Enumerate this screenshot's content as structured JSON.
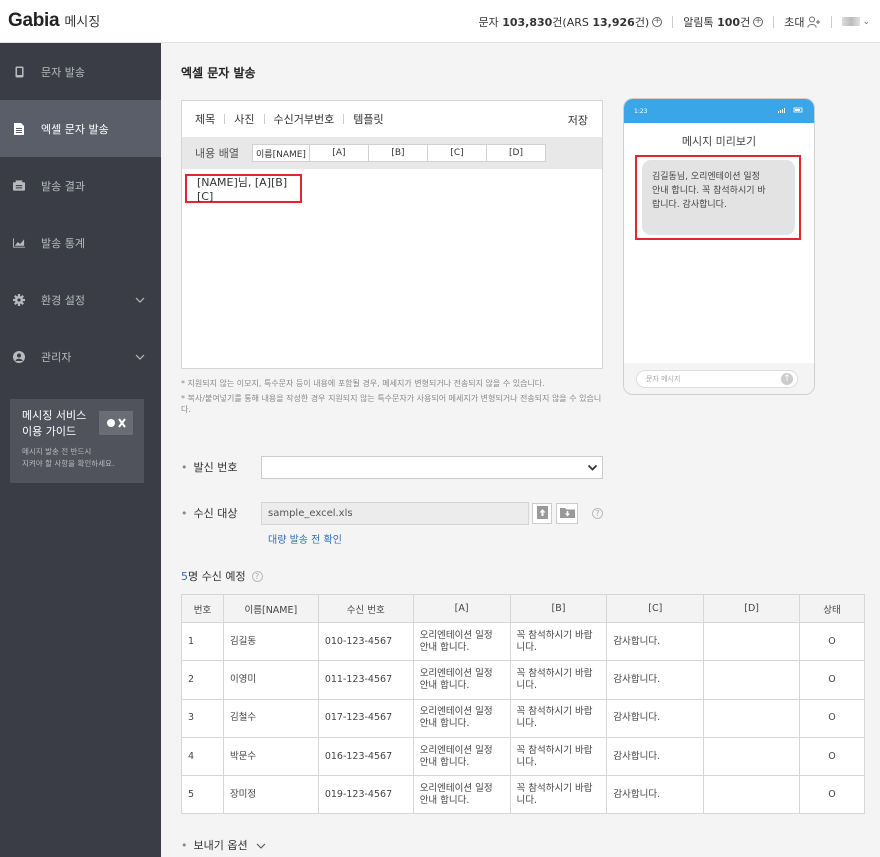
{
  "header": {
    "logo": "Gabia",
    "logo_sub": "메시징",
    "sms_label": "문자",
    "sms_count": "103,830",
    "sms_unit": "건(ARS",
    "ars_count": "13,926",
    "ars_unit": "건)",
    "alimtalk_label": "알림톡",
    "alimtalk_count": "100",
    "alimtalk_unit": "건",
    "invite_label": "초대"
  },
  "sidebar": {
    "items": [
      {
        "label": "문자 발송",
        "icon": "phone-icon"
      },
      {
        "label": "엑셀 문자 발송",
        "icon": "document-icon"
      },
      {
        "label": "발송 결과",
        "icon": "result-icon"
      },
      {
        "label": "발송 통계",
        "icon": "chart-icon"
      },
      {
        "label": "환경 설정",
        "icon": "gear-icon"
      },
      {
        "label": "관리자",
        "icon": "user-icon"
      }
    ],
    "guide": {
      "title_line1": "메시징 서비스",
      "title_line2": "이용 가이드",
      "desc_line1": "메시지 발송 전 반드시",
      "desc_line2": "지켜야 할 사항을 확인하세요."
    }
  },
  "main": {
    "page_title": "엑셀 문자 발송",
    "editor": {
      "tabs": [
        "제목",
        "사진",
        "수신거부번호",
        "템플릿"
      ],
      "save_label": "저장",
      "order_label": "내용 배열",
      "order_cells": [
        "이름[NAME]",
        "[A]",
        "[B]",
        "[C]",
        "[D]"
      ],
      "message": "[NAME]님, [A][B][C]"
    },
    "notes": [
      "*  지원되지 않는 이모지, 특수문자 등이 내용에 포함될 경우, 메세지가 변형되거나 전송되지 않을 수 있습니다.",
      "*  복사/붙여넣기를 통해 내용을 작성한 경우 지원되지 않는 특수문자가 사용되어 메세지가 변형되거나 전송되지 않을 수 있습니다."
    ],
    "sender_label": "발신 번호",
    "sender_value": "",
    "recipient_label": "수신 대상",
    "file_name": "sample_excel.xls",
    "bulk_link": "대량 발송 전 확인",
    "recv_count": "5",
    "recv_title_suffix": "명 수신 예정",
    "table": {
      "headers": [
        "번호",
        "이름[NAME]",
        "수신 번호",
        "[A]",
        "[B]",
        "[C]",
        "[D]",
        "상태"
      ],
      "rows": [
        {
          "no": "1",
          "name": "김길동",
          "phone": "010-123-4567",
          "a1": "오리엔테이션 일정",
          "a2": "안내 합니다.",
          "b1": "꼭 참석하시기 바랍",
          "b2": "니다.",
          "c": "감사합니다.",
          "d": "",
          "status": "O"
        },
        {
          "no": "2",
          "name": "이영미",
          "phone": "011-123-4567",
          "a1": "오리엔테이션 일정",
          "a2": "안내 합니다.",
          "b1": "꼭 참석하시기 바랍",
          "b2": "니다.",
          "c": "감사합니다.",
          "d": "",
          "status": "O"
        },
        {
          "no": "3",
          "name": "김철수",
          "phone": "017-123-4567",
          "a1": "오리엔테이션 일정",
          "a2": "안내 합니다.",
          "b1": "꼭 참석하시기 바랍",
          "b2": "니다.",
          "c": "감사합니다.",
          "d": "",
          "status": "O"
        },
        {
          "no": "4",
          "name": "박문수",
          "phone": "016-123-4567",
          "a1": "오리엔테이션 일정",
          "a2": "안내 합니다.",
          "b1": "꼭 참석하시기 바랍",
          "b2": "니다.",
          "c": "감사합니다.",
          "d": "",
          "status": "O"
        },
        {
          "no": "5",
          "name": "장미정",
          "phone": "019-123-4567",
          "a1": "오리엔테이션 일정",
          "a2": "안내 합니다.",
          "b1": "꼭 참석하시기 바랍",
          "b2": "니다.",
          "c": "감사합니다.",
          "d": "",
          "status": "O"
        }
      ]
    },
    "send_options_label": "보내기 옵션"
  },
  "preview": {
    "time": "1:23",
    "title": "메시지 미리보기",
    "bubble_line1": "김길동님, 오리엔테이션 일정",
    "bubble_line2": "안내 합니다. 꼭 참석하시기 바",
    "bubble_line3": "랍니다. 감사합니다.",
    "input_placeholder": "문자 메시지"
  },
  "colors": {
    "sidebar_bg": "#3a3d45",
    "sidebar_active": "#5a5e68",
    "highlight_red": "#e2262e",
    "link_blue": "#2e6fb7",
    "phone_status": "#3aa6e8"
  }
}
